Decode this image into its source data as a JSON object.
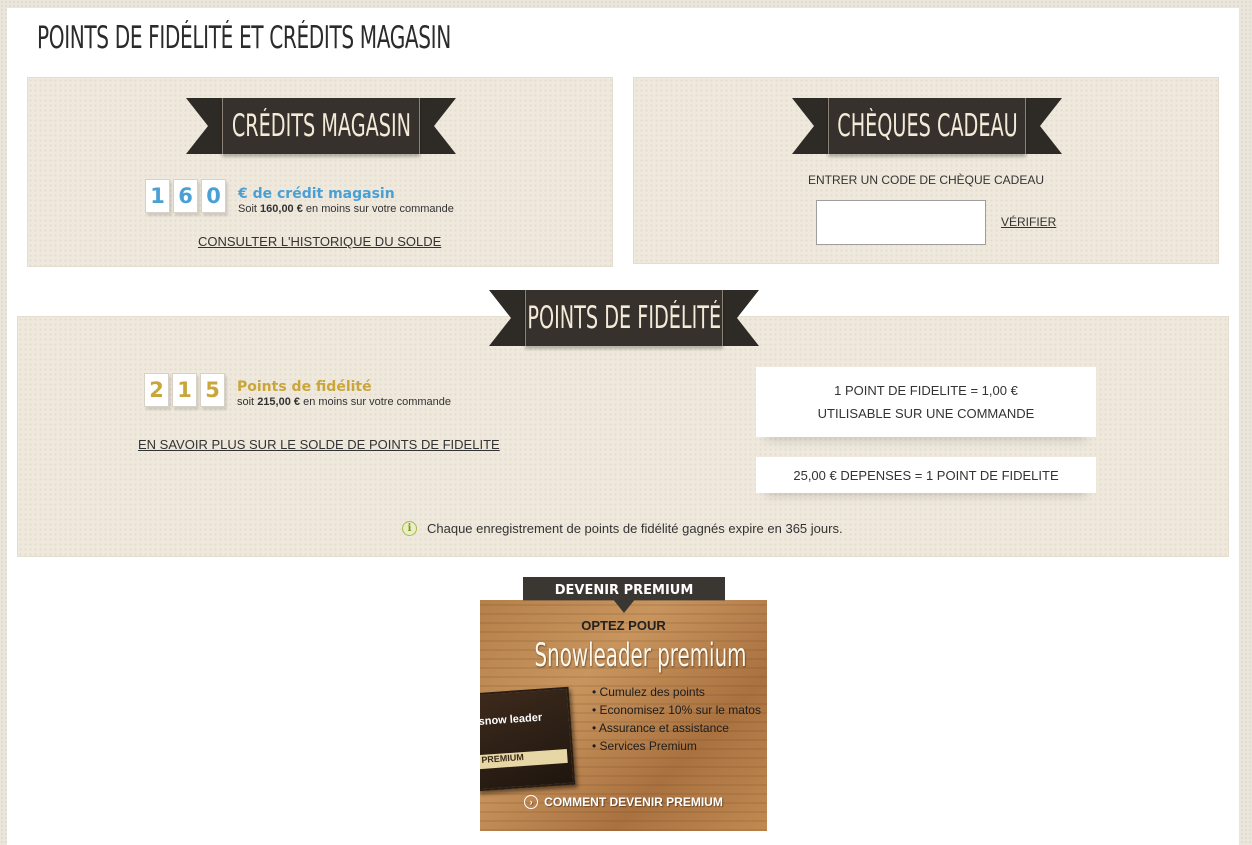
{
  "page": {
    "title": "Points de fidélité et crédits magasin"
  },
  "store_credit": {
    "banner": "Crédits magasin",
    "digits": [
      "1",
      "6",
      "0"
    ],
    "label": "€ de crédit magasin",
    "sub_prefix": "Soit",
    "sub_amount": "160,00 €",
    "sub_suffix": "en moins sur votre commande",
    "history_link": "CONSULTER L'HISTORIQUE DU SOLDE"
  },
  "gift_card": {
    "banner": "Chèques cadeau",
    "prompt": "ENTRER UN CODE DE CHÈQUE CADEAU",
    "input_value": "",
    "verify_label": "VÉRIFIER"
  },
  "loyalty": {
    "banner": "Points de fidélité",
    "digits": [
      "2",
      "1",
      "5"
    ],
    "label": "Points de fidélité",
    "sub_prefix": "soit",
    "sub_amount": "215,00 €",
    "sub_suffix": "en moins sur votre commande",
    "more_link": "EN SAVOIR PLUS SUR LE SOLDE DE POINTS DE FIDELITE",
    "rule_1_line1": "1 POINT DE FIDELITE = 1,00 €",
    "rule_1_line2": "UTILISABLE SUR UNE COMMANDE",
    "rule_2": "25,00 € DEPENSES = 1 POINT DE FIDELITE",
    "expiry_note": "Chaque enregistrement de points de fidélité gagnés expire en 365 jours."
  },
  "premium": {
    "tab": "DEVENIR PREMIUM",
    "optez": "OPTEZ POUR",
    "brand": "Snowleader premium",
    "card_brand": "snow leader",
    "card_label": "PREMIUM",
    "benefits": [
      "Cumulez des points",
      "Economisez 10% sur le matos",
      "Assurance et assistance",
      "Services Premium"
    ],
    "cta": "COMMENT DEVENIR PREMIUM"
  },
  "colors": {
    "credit_blue": "#4aa0d5",
    "loyalty_gold": "#c9a63c",
    "ribbon": "#36312c"
  }
}
